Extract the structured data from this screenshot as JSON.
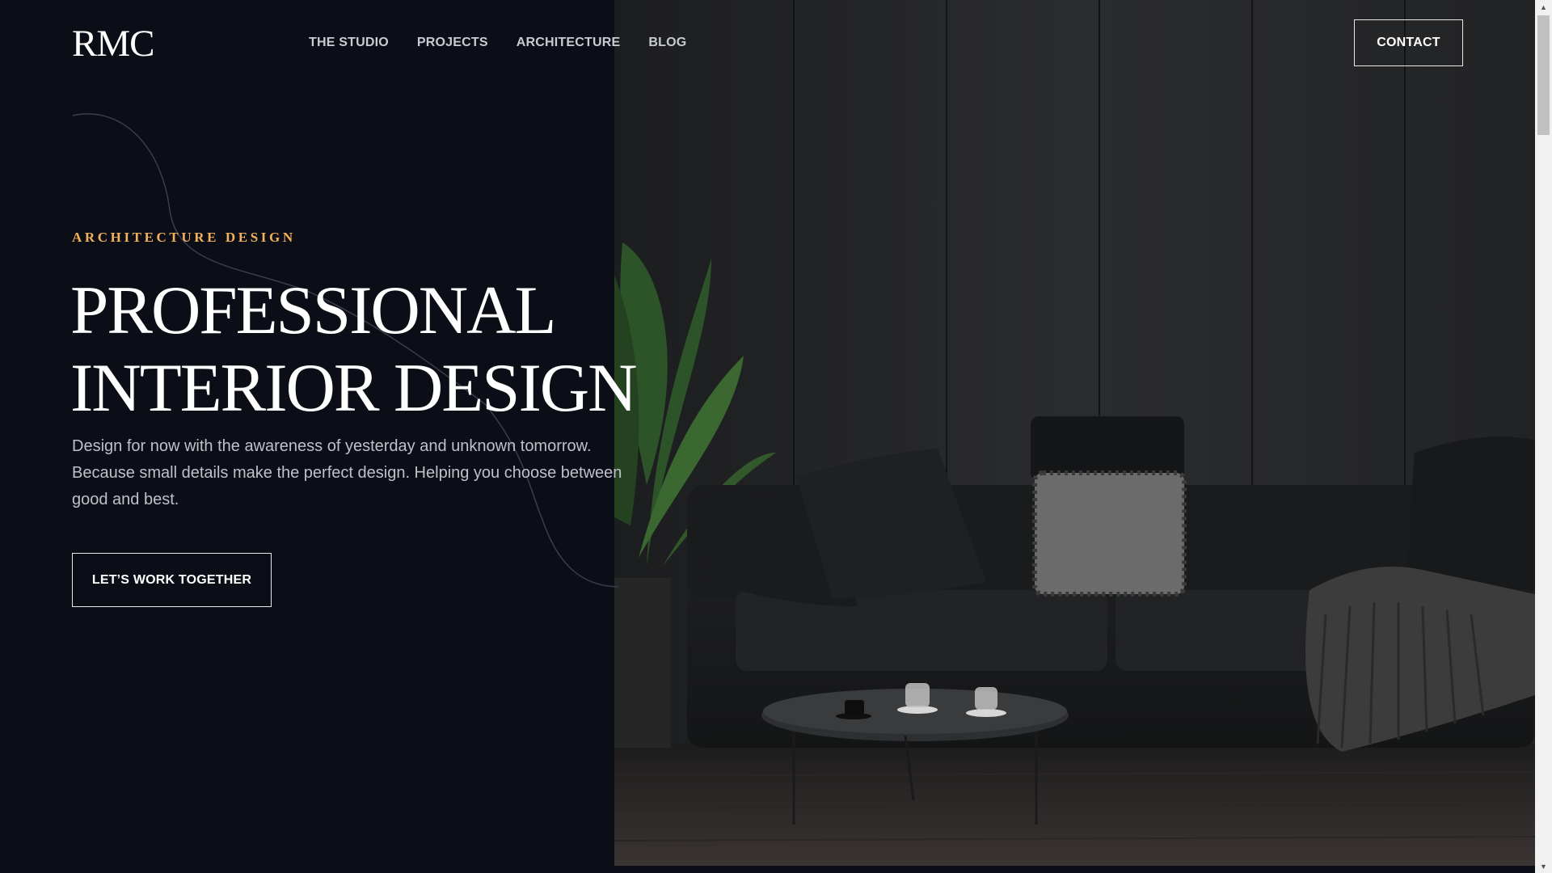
{
  "brand": {
    "logo": "RMC"
  },
  "nav": {
    "items": [
      {
        "label": "THE STUDIO"
      },
      {
        "label": "PROJECTS"
      },
      {
        "label": "ARCHITECTURE"
      },
      {
        "label": "BLOG"
      }
    ],
    "contact_label": "CONTACT"
  },
  "hero": {
    "eyebrow": "ARCHITECTURE DESIGN",
    "headline_line1": "PROFESSIONAL",
    "headline_line2": "INTERIOR DESIGN",
    "description": "Design for now with the awareness of yesterday and unknown tomorrow. Because small details make the perfect design. Helping you choose between good and best.",
    "cta_label": "LET’S WORK TOGETHER",
    "accent_color": "#f2b15c",
    "background_color": "#0c0e17",
    "image": "dark-living-room-photo"
  }
}
